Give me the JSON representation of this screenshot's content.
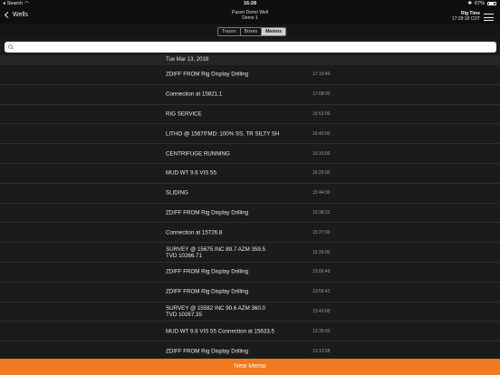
{
  "status_bar": {
    "carrier": "Search",
    "time": "16:28",
    "battery": "67%",
    "battery_level": 0.67
  },
  "nav": {
    "back_label": "Wells",
    "title_line1": "Pason Demo Well",
    "title_line2": "Demo 1",
    "rig_time_label": "Rig Time",
    "rig_time_value": "17:28:18 CDT"
  },
  "tabs": [
    {
      "label": "Traces",
      "active": false
    },
    {
      "label": "Boxes",
      "active": false
    },
    {
      "label": "Memos",
      "active": true
    }
  ],
  "search": {
    "placeholder": ""
  },
  "date_header": "Tue Mar 13, 2018",
  "memos": [
    {
      "text": "ZDIFF FROM Rig Display Drilling",
      "time": "17:19:46"
    },
    {
      "text": "Connection at 15821.1",
      "time": "17:08:00"
    },
    {
      "text": "RIG SERVICE",
      "time": "16:52:00"
    },
    {
      "text": "LITHO @ 15670'MD: 100% SS, TR SILTY SH",
      "time": "16:43:00"
    },
    {
      "text": "CENTRIFUGE RUNNING",
      "time": "16:33:00"
    },
    {
      "text": "MUD WT 9.6 VIS 55",
      "time": "16:25:00"
    },
    {
      "text": "SLIDING",
      "time": "15:44:00"
    },
    {
      "text": "ZDIFF FROM Rig Display Drilling",
      "time": "15:38:22"
    },
    {
      "text": "Connection at 15726.8",
      "time": "15:27:00"
    },
    {
      "text": "SURVEY @ 15675 INC 89.7 AZM 359.5\nTVD 10266.71",
      "time": "15:26:00"
    },
    {
      "text": "ZDIFF FROM Rig Display Drilling",
      "time": "15:00:49"
    },
    {
      "text": "ZDIFF FROM Rig Display Drilling",
      "time": "13:59:42"
    },
    {
      "text": "SURVEY @ 15582 INC 90.6 AZM 360.0\nTVD 10267.35",
      "time": "13:43:00"
    },
    {
      "text": "MUD WT 9.6 VIS 55 Connection at 15633.5",
      "time": "13:39:00"
    },
    {
      "text": "ZDIFF FROM Rig Display Drilling",
      "time": "13:13:58"
    }
  ],
  "new_memo_label": "New Memo",
  "colors": {
    "accent": "#f07a1f",
    "background": "#1b1b1b"
  }
}
